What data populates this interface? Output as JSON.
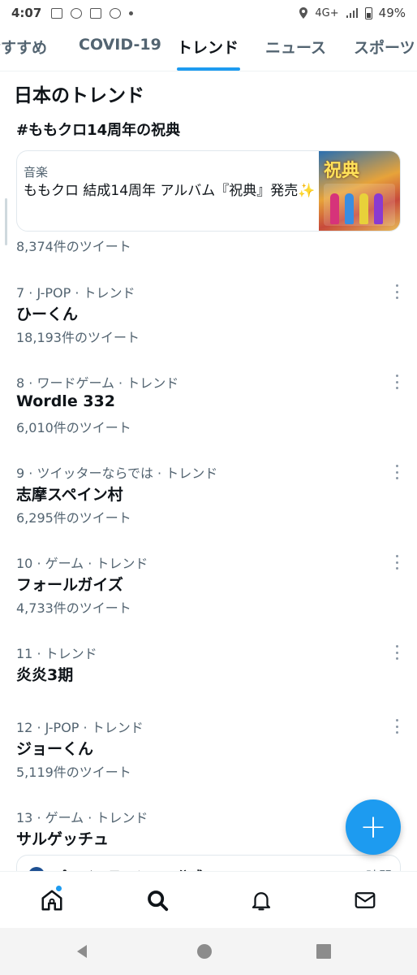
{
  "status_bar": {
    "time": "4:07",
    "network": "4G+",
    "battery": "49%"
  },
  "tabs": [
    {
      "label": "おすすめ",
      "active": false
    },
    {
      "label": "COVID-19",
      "active": false
    },
    {
      "label": "トレンド",
      "active": true
    },
    {
      "label": "ニュース",
      "active": false
    },
    {
      "label": "スポーツ",
      "active": false
    }
  ],
  "section": {
    "title": "日本のトレンド"
  },
  "promoted": {
    "title": "#ももクロ14周年の祝典",
    "card": {
      "category": "音楽",
      "text": "ももクロ 結成14周年 アルバム『祝典』発売✨",
      "image_caption": "祝典"
    },
    "tweet_count": "8,374件のツイート"
  },
  "trends": [
    {
      "meta": "7 · J-POP · トレンド",
      "name": "ひーくん",
      "count": "18,193件のツイート"
    },
    {
      "meta": "8 · ワードゲーム · トレンド",
      "name": "Wordle 332",
      "count": "6,010件のツイート"
    },
    {
      "meta": "9 · ツイッターならでは · トレンド",
      "name": "志摩スペイン村",
      "count": "6,295件のツイート"
    },
    {
      "meta": "10 · ゲーム · トレンド",
      "name": "フォールガイズ",
      "count": "4,733件のツイート"
    },
    {
      "meta": "11 · トレンド",
      "name": "炎炎3期",
      "count": ""
    },
    {
      "meta": "12 · J-POP · トレンド",
      "name": "ジョーくん",
      "count": "5,119件のツイート"
    },
    {
      "meta": "13 · ゲーム · トレンド",
      "name": "サルゲッチュ",
      "count": ""
    }
  ],
  "partial_card": {
    "text": "プレイステーション公式",
    "time": "時間"
  },
  "fab": {
    "label": "+",
    "icon": "plus-icon"
  },
  "bottom_nav": [
    {
      "name": "home",
      "icon": "home-icon"
    },
    {
      "name": "search",
      "icon": "search-icon",
      "active": true
    },
    {
      "name": "notifications",
      "icon": "bell-icon"
    },
    {
      "name": "messages",
      "icon": "mail-icon"
    }
  ],
  "colors": {
    "accent": "#1d9bf0",
    "text": "#0f1419",
    "secondary": "#536471"
  }
}
